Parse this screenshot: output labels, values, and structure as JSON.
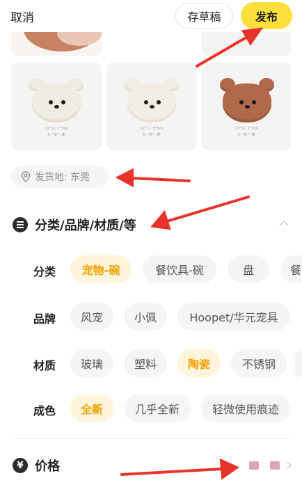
{
  "header": {
    "cancel_label": "取消",
    "draft_label": "存草稿",
    "publish_label": "发布"
  },
  "images": [
    {
      "caption1": "11*11.5*5cm",
      "caption2": "6-\"宏\"-蓬"
    },
    {
      "caption1": "11*11.5*5cm",
      "caption2": "6-\"宏\"-蓬"
    },
    {
      "caption1": "11*11.5*5cm",
      "caption2": "6-\"宏\"-蓬"
    }
  ],
  "location": {
    "label": "发货地: 东莞",
    "icon": "location-pin-icon"
  },
  "category_section": {
    "title": "分类/品牌/材质/等",
    "icon": "list-icon",
    "rows": [
      {
        "label": "分类",
        "options": [
          "宠物-碗",
          "餐饮具-碗",
          "盘",
          "餐"
        ],
        "selected": 0
      },
      {
        "label": "品牌",
        "options": [
          "风宠",
          "小佩",
          "Hoopet/华元宠具"
        ],
        "selected": -1
      },
      {
        "label": "材质",
        "options": [
          "玻璃",
          "塑料",
          "陶瓷",
          "不锈钢"
        ],
        "selected": 2
      },
      {
        "label": "成色",
        "options": [
          "全新",
          "几乎全新",
          "轻微使用痕迹"
        ],
        "selected": 0
      }
    ]
  },
  "price": {
    "label": "价格",
    "icon": "yen-icon"
  },
  "colors": {
    "accent": "#ffe03a",
    "selected_text": "#f0a200",
    "selected_bg": "#fff5dd",
    "annotation_arrow": "#e8332b"
  }
}
